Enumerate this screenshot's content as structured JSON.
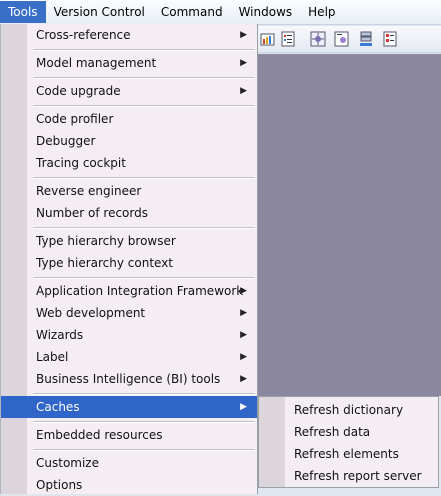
{
  "menubar": {
    "items": [
      "Tools",
      "Version Control",
      "Command",
      "Windows",
      "Help"
    ]
  },
  "menu": {
    "items": [
      {
        "label": "Cross-reference",
        "submenu": true
      },
      {
        "label": "Model management",
        "submenu": true
      },
      {
        "label": "Code upgrade",
        "submenu": true
      },
      {
        "label": "Code profiler",
        "submenu": false
      },
      {
        "label": "Debugger",
        "submenu": false
      },
      {
        "label": "Tracing cockpit",
        "submenu": false
      },
      {
        "label": "Reverse engineer",
        "submenu": false
      },
      {
        "label": "Number of records",
        "submenu": false
      },
      {
        "label": "Type hierarchy browser",
        "submenu": false
      },
      {
        "label": "Type hierarchy context",
        "submenu": false
      },
      {
        "label": "Application Integration Framework",
        "submenu": true
      },
      {
        "label": "Web development",
        "submenu": true
      },
      {
        "label": "Wizards",
        "submenu": true
      },
      {
        "label": "Label",
        "submenu": true
      },
      {
        "label": "Business Intelligence (BI) tools",
        "submenu": true
      },
      {
        "label": "Caches",
        "submenu": true,
        "selected": true
      },
      {
        "label": "Embedded resources",
        "submenu": false
      },
      {
        "label": "Customize",
        "submenu": false
      },
      {
        "label": "Options",
        "submenu": false
      }
    ],
    "arrow": "▶"
  },
  "submenu": {
    "items": [
      "Refresh dictionary",
      "Refresh data",
      "Refresh elements",
      "Refresh report server"
    ]
  },
  "colors": {
    "highlight": "#2f64c8",
    "menu_bg": "#f4eef4",
    "workspace": "#8b879f"
  }
}
